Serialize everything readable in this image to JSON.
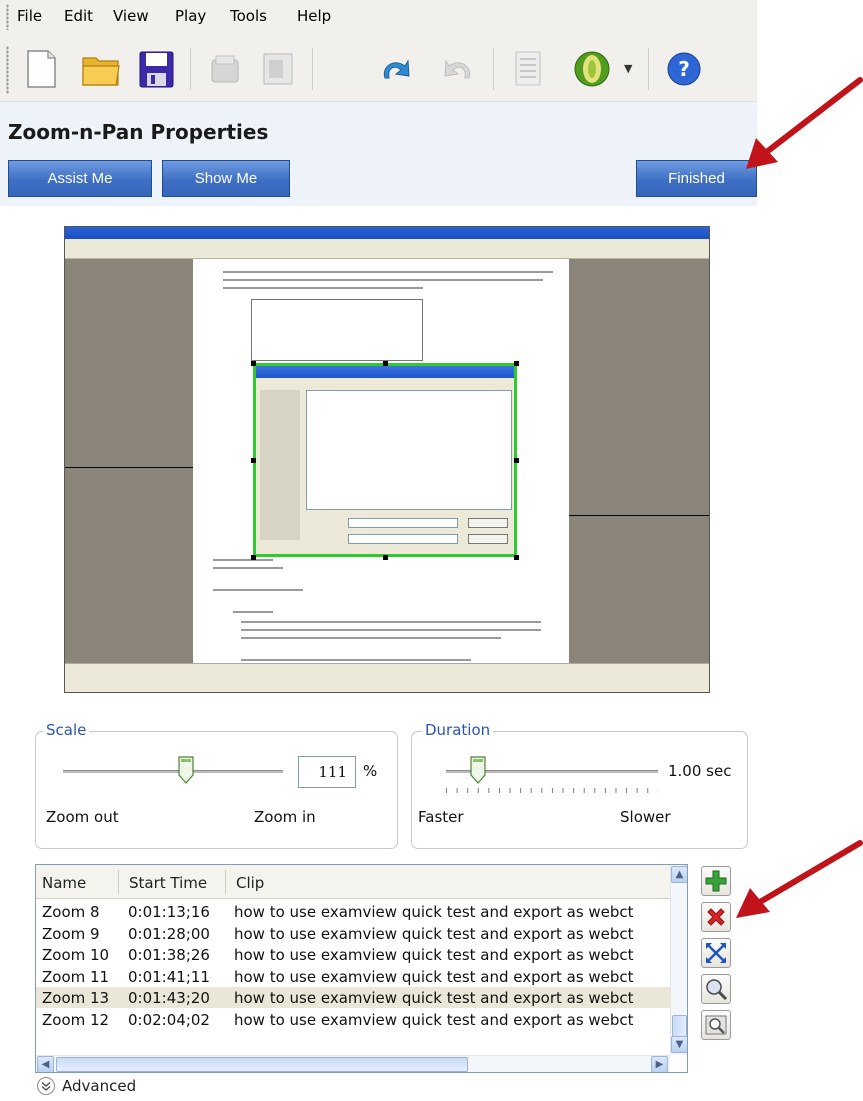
{
  "menu": {
    "items": [
      "File",
      "Edit",
      "View",
      "Play",
      "Tools",
      "Help"
    ]
  },
  "toolbar": {
    "buttons": [
      {
        "icon": "new-document-icon",
        "enabled": true
      },
      {
        "icon": "open-folder-icon",
        "enabled": true
      },
      {
        "icon": "save-icon",
        "enabled": true
      },
      {
        "icon": "import-icon",
        "enabled": false
      },
      {
        "icon": "export-icon",
        "enabled": false
      },
      {
        "icon": "undo-icon",
        "enabled": true
      },
      {
        "icon": "redo-icon",
        "enabled": false
      },
      {
        "icon": "checklist-icon",
        "enabled": false
      },
      {
        "icon": "produce-icon",
        "enabled": true
      },
      {
        "icon": "help-icon",
        "enabled": true
      }
    ]
  },
  "properties": {
    "title": "Zoom-n-Pan Properties",
    "assist_label": "Assist Me",
    "show_label": "Show Me",
    "finished_label": "Finished"
  },
  "scale": {
    "label": "Scale",
    "value": "111",
    "unit": "%",
    "min_label": "Zoom out",
    "max_label": "Zoom in",
    "slider_fraction": 0.56
  },
  "duration": {
    "label": "Duration",
    "value": "1.00 sec",
    "min_label": "Faster",
    "max_label": "Slower",
    "slider_fraction": 0.15
  },
  "list": {
    "columns": [
      "Name",
      "Start Time",
      "Clip"
    ],
    "rows": [
      {
        "name": "Zoom 8",
        "start": "0:01:13;16",
        "clip": "how to use examview quick test and export as webct",
        "selected": false
      },
      {
        "name": "Zoom 9",
        "start": "0:01:28;00",
        "clip": "how to use examview quick test and export as webct",
        "selected": false
      },
      {
        "name": "Zoom 10",
        "start": "0:01:38;26",
        "clip": "how to use examview quick test and export as webct",
        "selected": false
      },
      {
        "name": "Zoom 11",
        "start": "0:01:41;11",
        "clip": "how to use examview quick test and export as webct",
        "selected": false
      },
      {
        "name": "Zoom 13",
        "start": "0:01:43;20",
        "clip": "how to use examview quick test and export as webct",
        "selected": true
      },
      {
        "name": "Zoom 12",
        "start": "0:02:04;02",
        "clip": "how to use examview quick test and export as webct",
        "selected": false
      }
    ]
  },
  "side_buttons": [
    "add-icon",
    "delete-icon",
    "fit-icon",
    "zoom-to-icon",
    "preview-zoom-icon"
  ],
  "advanced": {
    "label": "Advanced"
  },
  "colors": {
    "accent_blue": "#3f6fc4",
    "group_label": "#2a55a6",
    "highlight_green": "#2ecc2e",
    "arrow_red": "#c0141a"
  }
}
